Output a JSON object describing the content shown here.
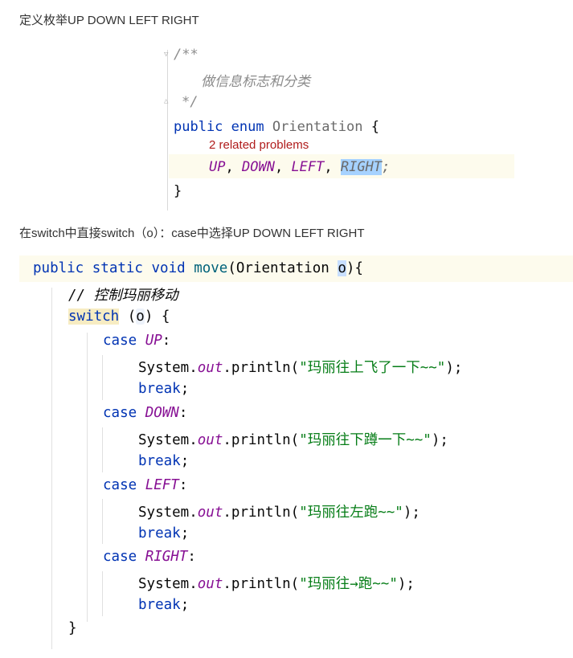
{
  "heading1": "定义枚举UP DOWN LEFT RIGHT",
  "heading2": "在switch中直接switch（o）：case中选择UP DOWN LEFT RIGHT",
  "enum_snippet": {
    "doc_open": "/**",
    "doc_text": "做信息标志和分类",
    "doc_close": "*/",
    "kw_public": "public",
    "kw_enum": "enum",
    "type_name": "Orientation",
    "brace_open": "{",
    "inspection_hint": "2 related problems",
    "const_up": "UP",
    "const_down": "DOWN",
    "const_left": "LEFT",
    "const_right": "RIGHT",
    "comma": ",",
    "semicolon": ";",
    "brace_close": "}"
  },
  "switch_snippet": {
    "sig_modifiers": "public static void",
    "sig_method": "move",
    "sig_params_open": "(Orientation ",
    "sig_param": "o",
    "sig_params_close": "){",
    "comment": "// 控制玛丽移动",
    "kw_switch": "switch",
    "switch_arg_open": " (",
    "switch_arg": "o",
    "switch_arg_close": ") {",
    "kw_case": "case",
    "kw_break": "break",
    "system": "System.",
    "out": "out",
    "println_open": ".println(",
    "println_close": ");",
    "colon": ":",
    "semi": ";",
    "cases": [
      {
        "label": "UP",
        "message": "\"玛丽往上飞了一下~~\""
      },
      {
        "label": "DOWN",
        "message": "\"玛丽往下蹲一下~~\""
      },
      {
        "label": "LEFT",
        "message": "\"玛丽往左跑~~\""
      },
      {
        "label": "RIGHT",
        "message": "\"玛丽往→跑~~\""
      }
    ],
    "close_switch": "}"
  }
}
